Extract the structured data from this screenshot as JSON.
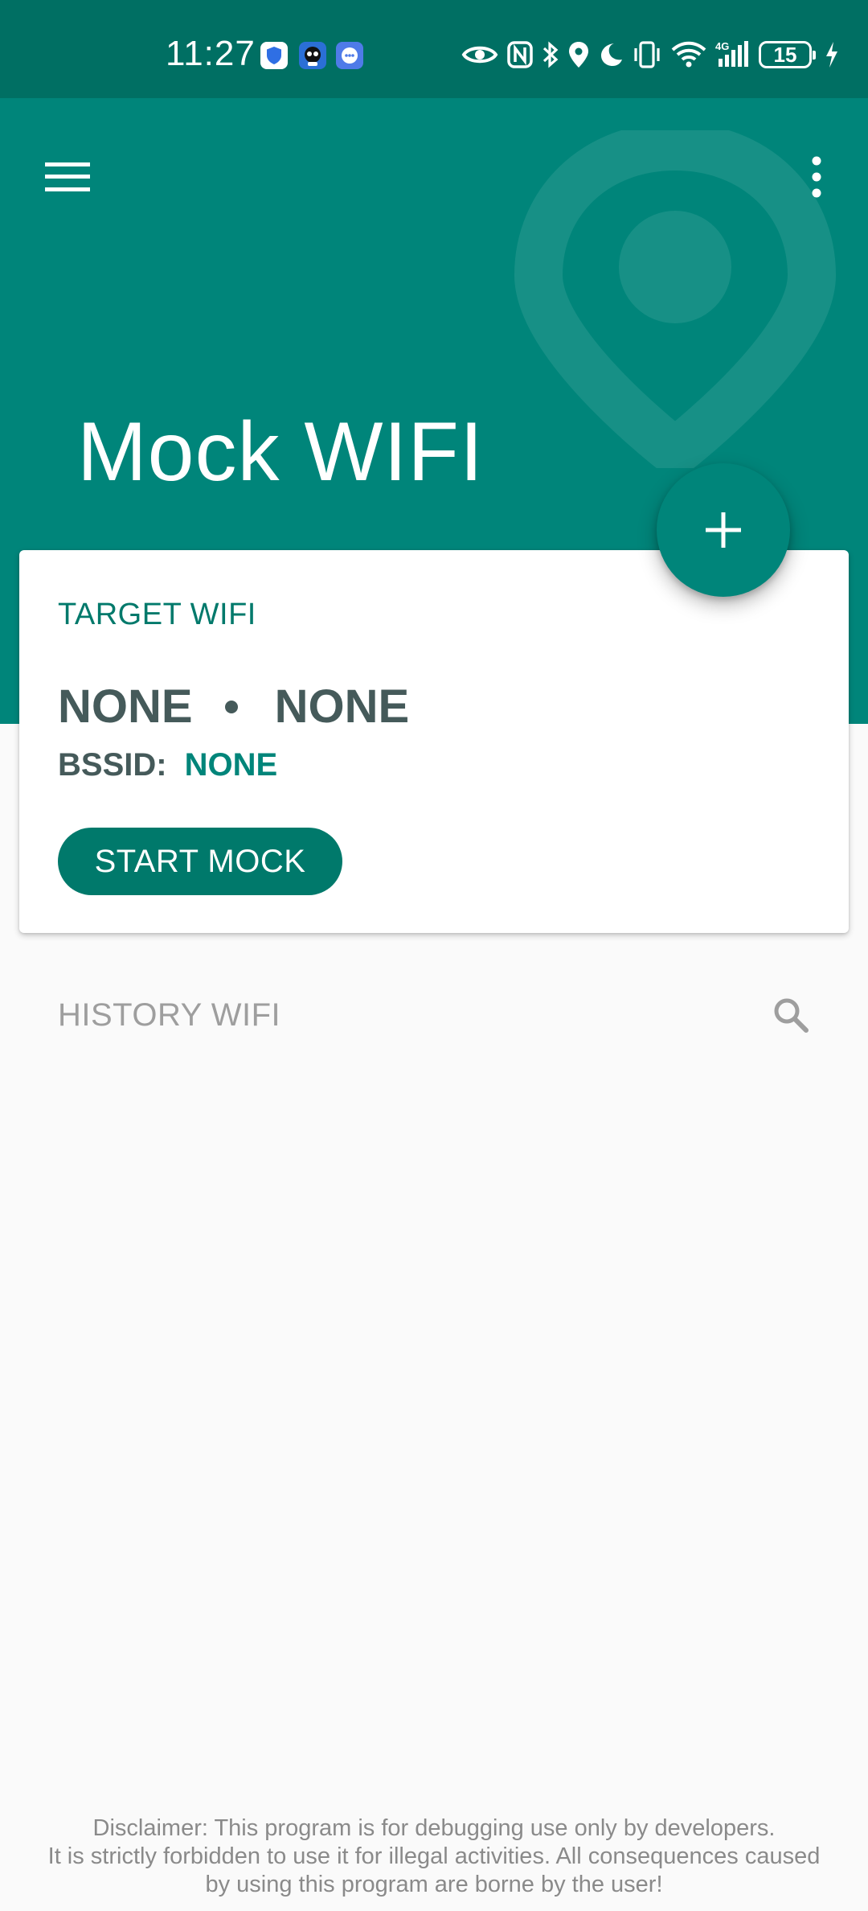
{
  "status_bar": {
    "time": "11:27",
    "battery_level": "15",
    "icons": [
      "shield-app-icon",
      "robot-app-icon",
      "chat-app-icon",
      "eye-icon",
      "nfc-icon",
      "bluetooth-icon",
      "location-icon",
      "moon-icon",
      "vibrate-icon",
      "wifi-icon",
      "network-4g-icon",
      "signal-icon",
      "battery-icon",
      "charging-icon"
    ]
  },
  "header": {
    "title": "Mock WIFI",
    "menu_icon": "menu-icon",
    "more_icon": "more-vert-icon",
    "background_color": "#00857a"
  },
  "fab": {
    "icon": "plus-icon"
  },
  "target_card": {
    "heading": "TARGET WIFI",
    "ssid": "NONE",
    "separator": "•",
    "security": "NONE",
    "bssid_label": "BSSID:",
    "bssid_value": "NONE",
    "start_button_label": "START MOCK",
    "accent_color": "#00796b"
  },
  "history": {
    "title": "HISTORY WIFI",
    "search_icon": "search-icon"
  },
  "disclaimer": {
    "line1": "Disclaimer: This program is for debugging use only by developers.",
    "line2": "It is strictly forbidden to use it for illegal activities. All consequences caused",
    "line3": "by using this program are borne by the user!"
  }
}
